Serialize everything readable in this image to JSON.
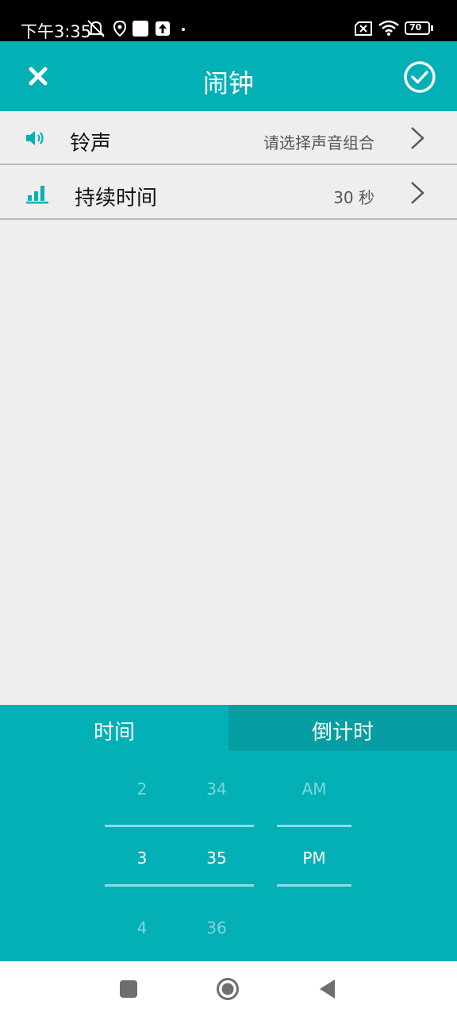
{
  "status_bar": {
    "time": "下午3:35",
    "battery": "70",
    "icons": [
      "mute-icon",
      "location-icon",
      "notification-square-icon",
      "upload-icon",
      "dot-icon",
      "sim-error-icon",
      "wifi-icon",
      "battery-icon"
    ]
  },
  "header": {
    "title": "闹钟",
    "close_icon": "close-icon",
    "confirm_icon": "check-circle-icon"
  },
  "rows": [
    {
      "icon": "speaker-icon",
      "label": "铃声",
      "value": "请选择声音组合"
    },
    {
      "icon": "signal-bars-icon",
      "label": "持续时间",
      "value": "30 秒"
    }
  ],
  "tabs": {
    "time": "时间",
    "countdown": "倒计时",
    "active": "time"
  },
  "picker": {
    "hours": [
      "2",
      "3",
      "4"
    ],
    "minutes": [
      "34",
      "35",
      "36"
    ],
    "ampm": [
      "AM",
      "PM"
    ],
    "selected": {
      "hour": "3",
      "minute": "35",
      "ampm": "PM"
    }
  },
  "colors": {
    "accent": "#03b0b6",
    "tab_inactive": "#069ea2",
    "background": "#eeeeee"
  },
  "nav": {
    "icons": [
      "recents-square-icon",
      "home-circle-icon",
      "back-triangle-icon"
    ]
  }
}
